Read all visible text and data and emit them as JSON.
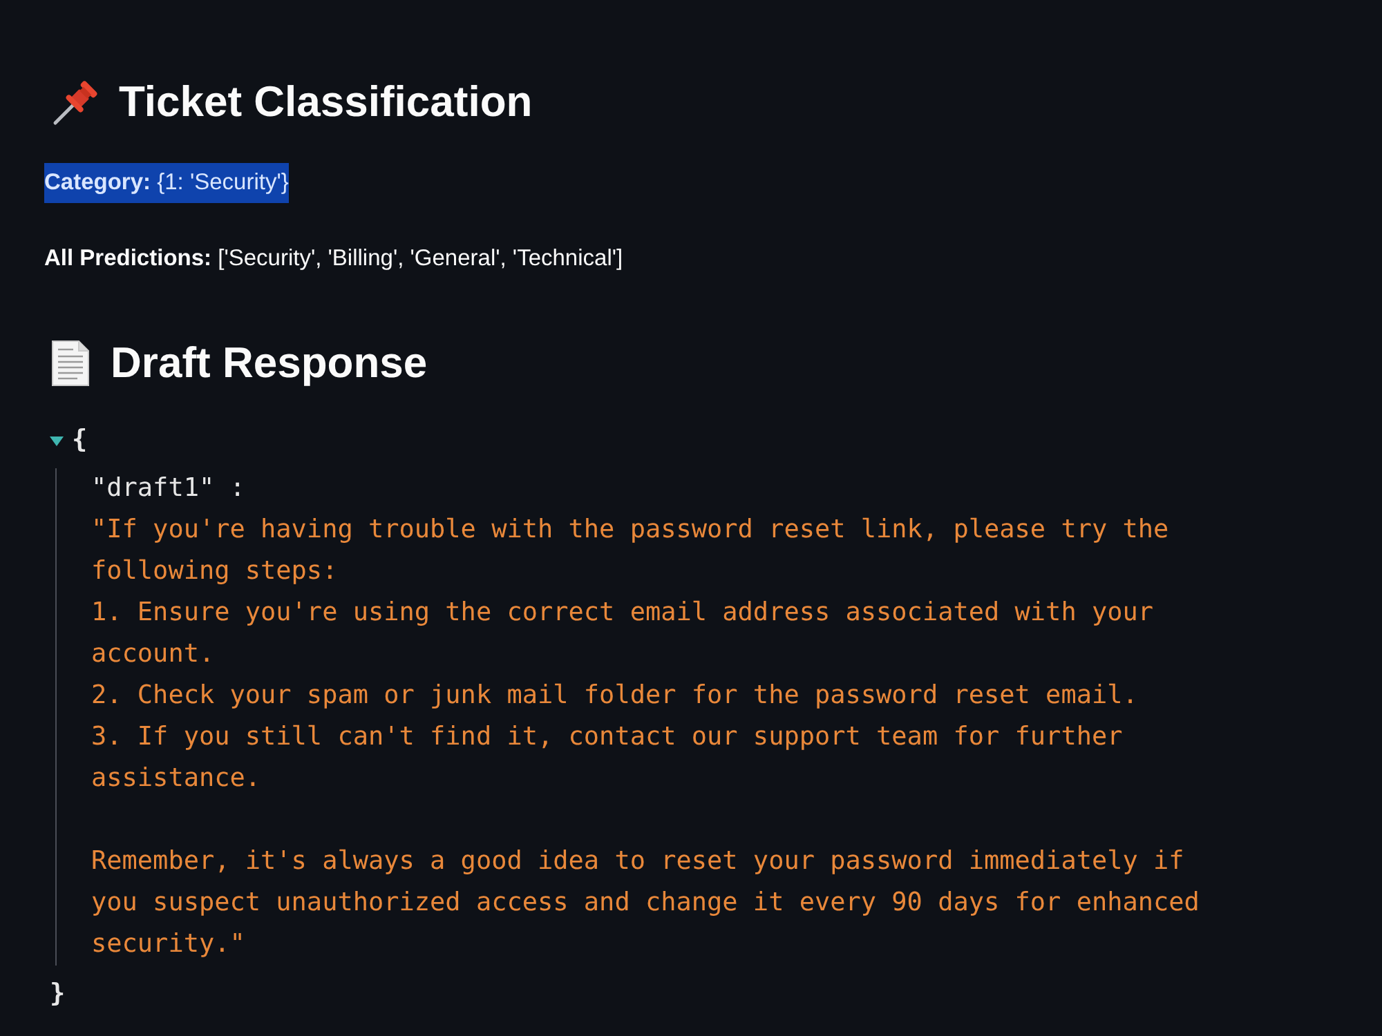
{
  "classification": {
    "title": "Ticket Classification",
    "lines": [
      {
        "text": "**Category:** {1: 'Security'}",
        "selected": true
      },
      {
        "text": "**All Predictions:** ['Security', 'Billing', 'General', 'Technical']",
        "selected": false
      }
    ]
  },
  "draft_response": {
    "title": "Draft Response",
    "json_viewer": {
      "expanded": true,
      "open_brace": "{",
      "key": "\"draft1\" :",
      "value": "\"If you're having trouble with the password reset link, please try the following steps:\n1. Ensure you're using the correct email address associated with your account.\n2. Check your spam or junk mail folder for the password reset email.\n3. If you still can't find it, contact our support team for further assistance.\n\nRemember, it's always a good idea to reset your password immediately if you suspect unauthorized access and change it every 90 days for enhanced security.\"",
      "close_brace": "}"
    }
  }
}
